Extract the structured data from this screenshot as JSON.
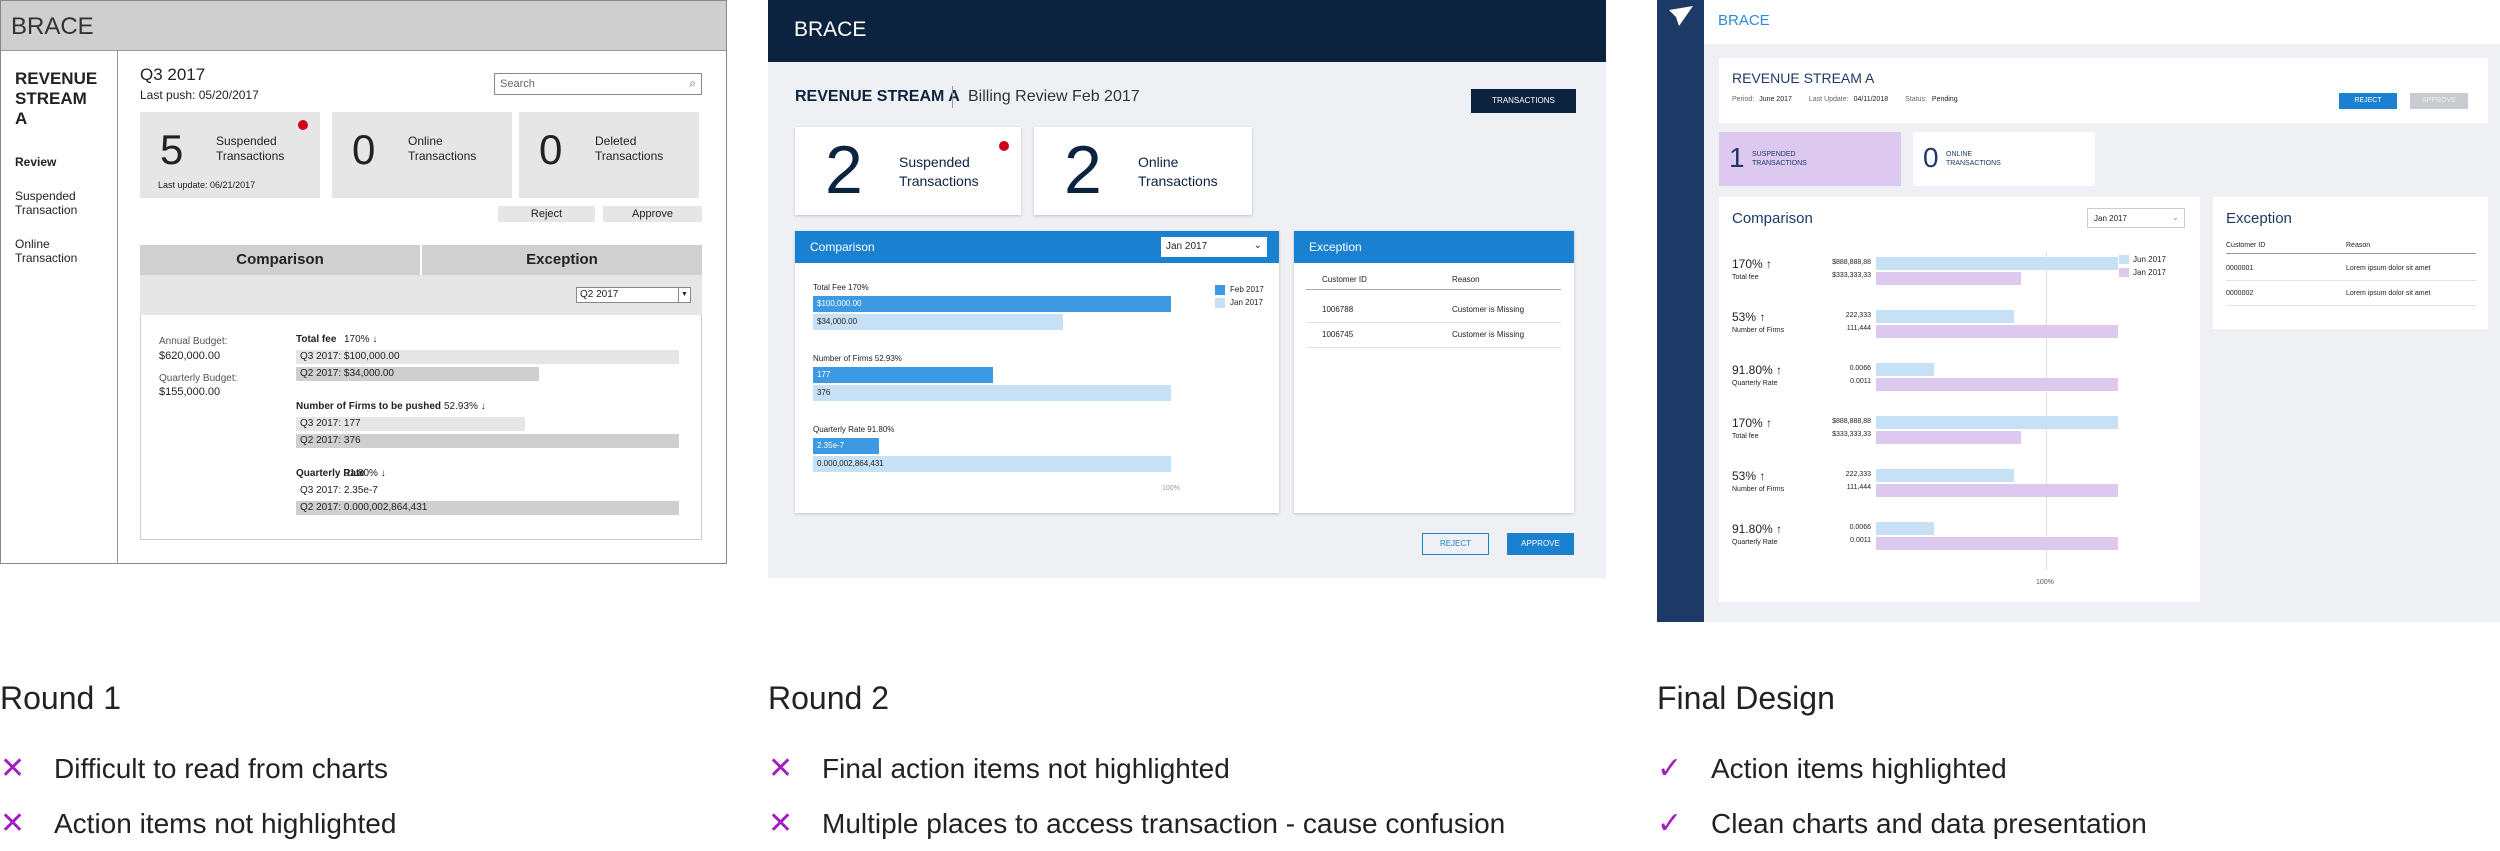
{
  "round1": {
    "app": "BRACE",
    "stream": "REVENUE STREAM A",
    "nav": [
      "Review",
      "Suspended Transaction",
      "Online Transaction"
    ],
    "period": "Q3 2017",
    "last_push": "Last push: 05/20/2017",
    "search_placeholder": "Search",
    "tiles": [
      {
        "n": "5",
        "label": "Suspended Transactions"
      },
      {
        "n": "0",
        "label": "Online Transactions"
      },
      {
        "n": "0",
        "label": "Deleted Transactions"
      }
    ],
    "last_update": "Last update: 06/21/2017",
    "reject": "Reject",
    "approve": "Approve",
    "tabs": [
      "Comparison",
      "Exception"
    ],
    "quarter_select": "Q2 2017",
    "annual_label": "Annual Budget:",
    "annual_value": "$620,000.00",
    "quarterly_label": "Quarterly Budget:",
    "quarterly_value": "$155,000.00",
    "metrics": [
      {
        "title": "Total fee",
        "pct": "170%",
        "a": "Q3 2017: $100,000.00",
        "b": "Q2 2017: $34,000.00"
      },
      {
        "title": "Number of Firms to be pushed",
        "pct": "52.93%",
        "a": "Q3 2017: 177",
        "b": "Q2 2017: 376"
      },
      {
        "title": "Quarterly Rate",
        "pct": "91.80%",
        "a": "Q3 2017: 2.35e-7",
        "b": "Q2 2017: 0.000,002,864,431"
      }
    ]
  },
  "round2": {
    "app": "BRACE",
    "stream": "REVENUE STREAM A",
    "sub": "Billing Review Feb 2017",
    "transactions_btn": "TRANSACTIONS",
    "tiles": [
      {
        "n": "2",
        "label": "Suspended Transactions"
      },
      {
        "n": "2",
        "label": "Online Transactions"
      }
    ],
    "comparison": "Comparison",
    "month_select": "Jan 2017",
    "legend": [
      "Feb 2017",
      "Jan 2017"
    ],
    "metrics": [
      {
        "title": "Total Fee",
        "pct": "170%",
        "a": "$100,000.00",
        "b": "$34,000.00"
      },
      {
        "title": "Number of Firms",
        "pct": "52.93%",
        "a": "177",
        "b": "376"
      },
      {
        "title": "Quarterly Rate",
        "pct": "91.80%",
        "a": "2.35e-7",
        "b": "0.000,002,864,431"
      }
    ],
    "axis_label": "100%",
    "exception": "Exception",
    "exc_cols": [
      "Customer ID",
      "Reason"
    ],
    "exc_rows": [
      [
        "1006788",
        "Customer is Missing"
      ],
      [
        "1006745",
        "Customer is Missing"
      ]
    ],
    "reject": "REJECT",
    "approve": "APPROVE"
  },
  "final": {
    "app": "BRACE",
    "stream": "REVENUE STREAM A",
    "period_label": "Period:",
    "period": "June 2017",
    "update_label": "Last Update:",
    "update": "04/11/2018",
    "status_label": "Status:",
    "status": "Pending",
    "reject": "REJECT",
    "approve": "APPROVE",
    "tiles": [
      {
        "n": "1",
        "label": "SUSPENDED TRANSACTIONS"
      },
      {
        "n": "0",
        "label": "ONLINE TRANSACTIONS"
      }
    ],
    "comparison": "Comparison",
    "month_select": "Jan 2017",
    "legend": [
      "Jun 2017",
      "Jan 2017"
    ],
    "metrics": [
      {
        "pct": "170%",
        "name": "Total fee",
        "a": "$888,888,88",
        "b": "$333,333,33",
        "fa": 1.0,
        "fb": 0.6
      },
      {
        "pct": "53%",
        "name": "Number of Firms",
        "a": "222,333",
        "b": "111,444",
        "fa": 0.57,
        "fb": 1.0
      },
      {
        "pct": "91.80%",
        "name": "Quarterly Rate",
        "a": "0.0066",
        "b": "0.0011",
        "fa": 0.24,
        "fb": 1.0
      },
      {
        "pct": "170%",
        "name": "Total fee",
        "a": "$888,888,88",
        "b": "$333,333,33",
        "fa": 1.0,
        "fb": 0.6
      },
      {
        "pct": "53%",
        "name": "Number of Firms",
        "a": "222,333",
        "b": "111,444",
        "fa": 0.57,
        "fb": 1.0
      },
      {
        "pct": "91.80%",
        "name": "Quarterly Rate",
        "a": "0.0066",
        "b": "0.0011",
        "fa": 0.24,
        "fb": 1.0
      }
    ],
    "axis_label": "100%",
    "exception": "Exception",
    "exc_cols": [
      "Customer ID",
      "Reason"
    ],
    "exc_rows": [
      [
        "0000001",
        "Lorem ipsum dolor sit amet"
      ],
      [
        "0000002",
        "Lorem ipsum dolor sit amet"
      ]
    ]
  },
  "captions": [
    {
      "title": "Round 1",
      "items": [
        {
          "mark": "cross",
          "text": "Difficult to read from charts"
        },
        {
          "mark": "cross",
          "text": "Action items not highlighted"
        }
      ]
    },
    {
      "title": "Round 2",
      "items": [
        {
          "mark": "cross",
          "text": "Final action items not highlighted"
        },
        {
          "mark": "cross",
          "text": "Multiple places to access transaction - cause confusion"
        }
      ]
    },
    {
      "title": "Final Design",
      "items": [
        {
          "mark": "check",
          "text": "Action items highlighted"
        },
        {
          "mark": "check",
          "text": "Clean charts and data presentation"
        }
      ]
    }
  ],
  "colors": {
    "navy": "#0c2340",
    "blue": "#1a80d0",
    "lightblue": "#c6e0f5",
    "purple": "#ddc8ef",
    "mark": "#a21fbf"
  }
}
